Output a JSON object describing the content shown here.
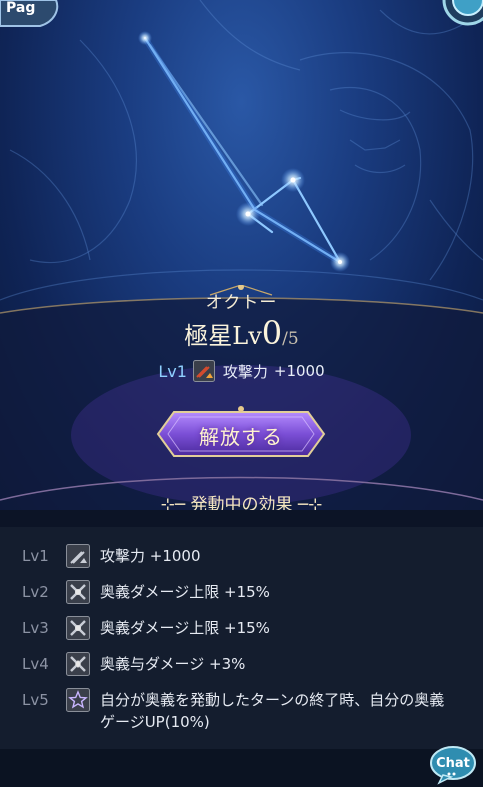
{
  "header": {
    "left_tab_partial": "Pag"
  },
  "summon": {
    "name": "オクトー",
    "rank_label": "極星Lv",
    "rank_current": "0",
    "rank_max": "/5",
    "current_effect": {
      "level": "Lv1",
      "icon": "attack-up-icon",
      "name": "攻撃力",
      "value": "+1000"
    },
    "release_button": "解放する"
  },
  "effects_tab": {
    "label": "発動中の効果"
  },
  "effects": [
    {
      "level": "Lv1",
      "icon": "attack-up-icon",
      "text": "攻撃力 +1000"
    },
    {
      "level": "Lv2",
      "icon": "ougi-cap-icon",
      "text": "奥義ダメージ上限 +15%"
    },
    {
      "level": "Lv3",
      "icon": "ougi-cap-icon",
      "text": "奥義ダメージ上限 +15%"
    },
    {
      "level": "Lv4",
      "icon": "ougi-dmg-icon",
      "text": "奥義与ダメージ +3%"
    },
    {
      "level": "Lv5",
      "icon": "star-icon",
      "text": "自分が奥義を発動したターンの終了時、自分の奥義ゲージUP(10%)"
    }
  ],
  "chat_button": "Chat",
  "colors": {
    "accent_blue": "#8fd0ff",
    "gold": "#f4e6c0",
    "panel": "#141d2e",
    "purple_button": "#7b4fd6"
  }
}
